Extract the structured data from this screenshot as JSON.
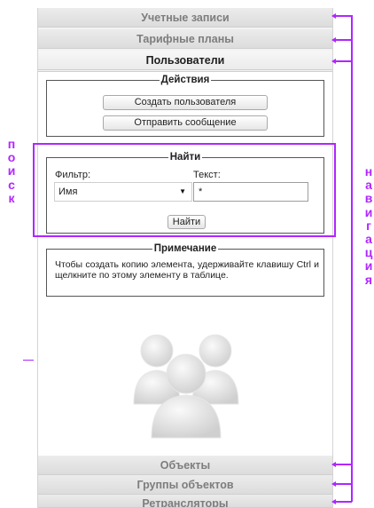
{
  "accordion": {
    "accounts": "Учетные записи",
    "tariffs": "Тарифные планы",
    "users": "Пользователи",
    "objects": "Объекты",
    "object_groups": "Группы объектов",
    "repeaters": "Ретрансляторы"
  },
  "actions": {
    "legend": "Действия",
    "create_user": "Создать пользователя",
    "send_message": "Отправить сообщение"
  },
  "search": {
    "legend": "Найти",
    "filter_label": "Фильтр:",
    "filter_value": "Имя",
    "text_label": "Текст:",
    "text_value": "*",
    "find_button": "Найти"
  },
  "note": {
    "legend": "Примечание",
    "text": "Чтобы создать копию элемента, удерживайте клавишу Ctrl и щелкните по этому элементу в таблице."
  },
  "annotations": {
    "left_vertical": [
      "п",
      "о",
      "и",
      "с",
      "к"
    ],
    "right_vertical": [
      "н",
      "а",
      "в",
      "и",
      "г",
      "а",
      "ц",
      "и",
      "я"
    ],
    "color": "#b026ff"
  },
  "icons": {
    "users_graphic": "users-group-icon",
    "dropdown": "chevron-down-icon"
  }
}
